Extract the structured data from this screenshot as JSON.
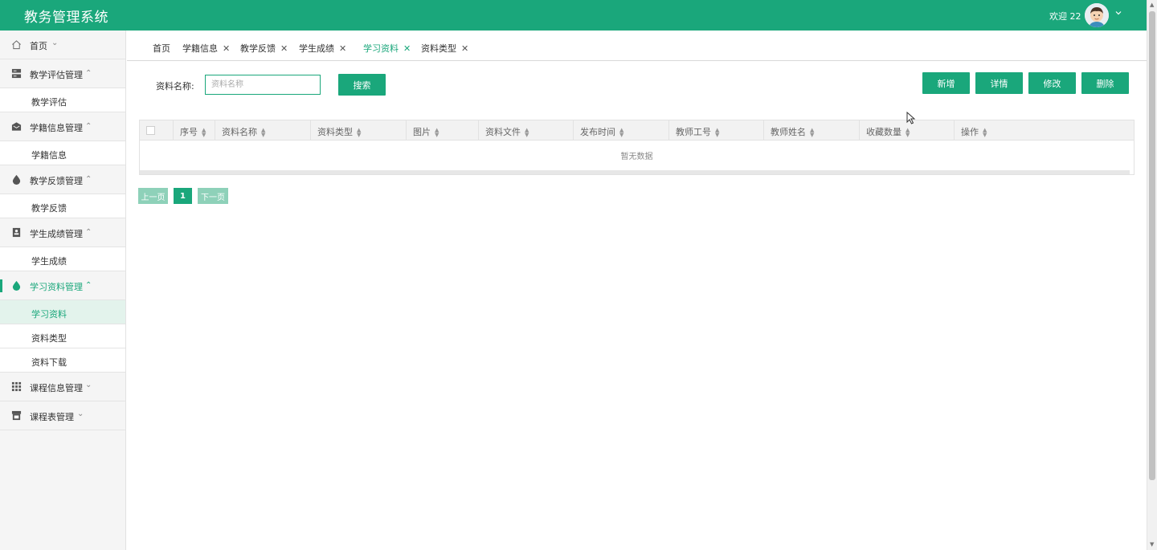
{
  "app": {
    "title": "教务管理系统",
    "welcome": "欢迎 22"
  },
  "sidebar": {
    "home": {
      "label": "首页",
      "icon": "home-icon"
    },
    "groups": [
      {
        "label": "教学评估管理",
        "icon": "server-icon",
        "items": [
          "教学评估"
        ]
      },
      {
        "label": "学籍信息管理",
        "icon": "mail-icon",
        "items": [
          "学籍信息"
        ]
      },
      {
        "label": "教学反馈管理",
        "icon": "drop-icon",
        "items": [
          "教学反馈"
        ]
      },
      {
        "label": "学生成绩管理",
        "icon": "id-card-icon",
        "items": [
          "学生成绩"
        ]
      },
      {
        "label": "学习资料管理",
        "icon": "drop-icon",
        "items": [
          "学习资料",
          "资料类型",
          "资料下载"
        ]
      },
      {
        "label": "课程信息管理",
        "icon": "grid-icon",
        "items": []
      },
      {
        "label": "课程表管理",
        "icon": "store-icon",
        "items": []
      }
    ]
  },
  "tabs": [
    {
      "label": "首页",
      "closable": false
    },
    {
      "label": "学籍信息",
      "closable": true
    },
    {
      "label": "教学反馈",
      "closable": true
    },
    {
      "label": "学生成绩",
      "closable": true
    },
    {
      "label": "学习资料",
      "closable": true,
      "active": true
    },
    {
      "label": "资料类型",
      "closable": true
    }
  ],
  "search": {
    "label": "资料名称:",
    "placeholder": "资料名称",
    "button": "搜索"
  },
  "actions": {
    "add": "新增",
    "detail": "详情",
    "edit": "修改",
    "delete": "删除"
  },
  "table": {
    "columns": [
      "序号",
      "资料名称",
      "资料类型",
      "图片",
      "资料文件",
      "发布时间",
      "教师工号",
      "教师姓名",
      "收藏数量",
      "操作"
    ],
    "empty_text": "暂无数据"
  },
  "pagination": {
    "prev": "上一页",
    "current": "1",
    "next": "下一页"
  },
  "colors": {
    "primary": "#1aa77b",
    "primary_light": "#8ed1b9"
  }
}
